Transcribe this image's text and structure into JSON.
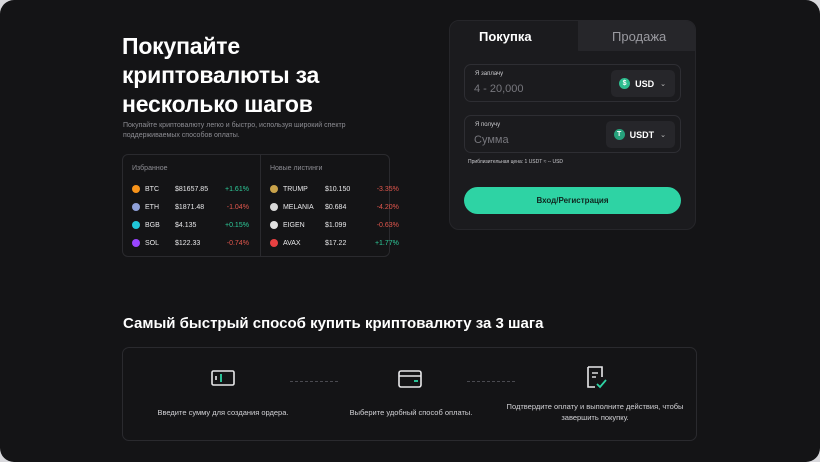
{
  "hero": {
    "title_line1": "Покупайте",
    "title_line2": "криптовалюты за",
    "title_line3": "несколько шагов",
    "subtitle": "Покупайте криптовалюту легко и быстро, используя широкий спектр поддерживаемых способов оплаты."
  },
  "markets": {
    "favorites": {
      "header": "Избранное",
      "rows": [
        {
          "symbol": "BTC",
          "price": "$81657.85",
          "change": "+1.61%",
          "dir": "up",
          "color": "#f7931a"
        },
        {
          "symbol": "ETH",
          "price": "$1871.48",
          "change": "-1.04%",
          "dir": "down",
          "color": "#8fa0d8"
        },
        {
          "symbol": "BGB",
          "price": "$4.135",
          "change": "+0.15%",
          "dir": "up",
          "color": "#20c5d8"
        },
        {
          "symbol": "SOL",
          "price": "$122.33",
          "change": "-0.74%",
          "dir": "down",
          "color": "#9945ff"
        }
      ]
    },
    "new_listings": {
      "header": "Новые листинги",
      "rows": [
        {
          "symbol": "TRUMP",
          "price": "$10.150",
          "change": "-3.35%",
          "dir": "down",
          "color": "#c9a24a"
        },
        {
          "symbol": "MELANIA",
          "price": "$0.684",
          "change": "-4.20%",
          "dir": "down",
          "color": "#d8d8d8"
        },
        {
          "symbol": "EIGEN",
          "price": "$1.099",
          "change": "-0.63%",
          "dir": "down",
          "color": "#e0e0e0"
        },
        {
          "symbol": "AVAX",
          "price": "$17.22",
          "change": "+1.77%",
          "dir": "up",
          "color": "#e84142"
        }
      ]
    }
  },
  "trade": {
    "tab_buy": "Покупка",
    "tab_sell": "Продажа",
    "pay": {
      "label": "Я заплачу",
      "placeholder": "4 - 20,000",
      "currency": "USD",
      "icon_glyph": "$",
      "color": "#2ebd8f"
    },
    "receive": {
      "label": "Я получу",
      "placeholder": "Сумма",
      "currency": "USDT",
      "icon_glyph": "T",
      "color": "#26a17b"
    },
    "rate": "Приблизительная цена: 1 USDT ≈ -- USD",
    "login_button": "Вход/Регистрация"
  },
  "steps": {
    "title": "Самый быстрый способ купить криптовалюту за 3 шага",
    "items": [
      {
        "text": "Введите сумму для создания ордера."
      },
      {
        "text": "Выберите удобный способ оплаты."
      },
      {
        "text": "Подтвердите оплату и выполните действия, чтобы завершить покупку."
      }
    ]
  },
  "colors": {
    "accent": "#2ed3a4",
    "up": "#2ecc9a",
    "down": "#e3574d",
    "background": "#141416"
  }
}
